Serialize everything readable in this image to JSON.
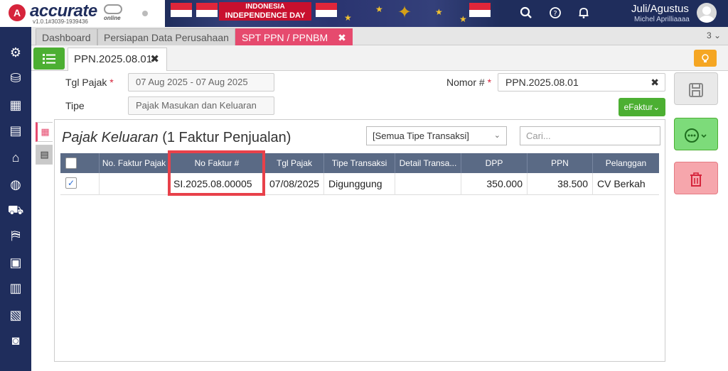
{
  "app": {
    "logo_mark": "A",
    "logo_text": "accurate",
    "logo_sub": "online",
    "version": "v1.0.1#3039-1939436"
  },
  "banner": {
    "line1": "INDONESIA",
    "line2": "INDEPENDENCE DAY"
  },
  "user": {
    "period": "Juli/Agustus",
    "name": "Michel Aprilliaaaa"
  },
  "tabs": [
    {
      "label": "Dashboard"
    },
    {
      "label": "Persiapan Data Perusahaan"
    },
    {
      "label": "SPT PPN / PPNBM",
      "close": "✖"
    }
  ],
  "tab_count": "3 ⌄",
  "doc_tab": {
    "label": "PPN.2025.08.01",
    "close": "✖"
  },
  "form": {
    "tgl_pajak_label": "Tgl Pajak",
    "tgl_pajak_value": "07 Aug 2025 - 07 Aug 2025",
    "tipe_label": "Tipe",
    "tipe_value": "Pajak Masukan dan Keluaran",
    "nomor_label": "Nomor #",
    "nomor_value": "PPN.2025.08.01",
    "required_mark": "*",
    "clear_icon": "✖",
    "efaktur_label": "eFaktur⌄"
  },
  "panel": {
    "title_italic": "Pajak Keluaran",
    "title_rest": " (1 Faktur Penjualan)",
    "filter_value": "[Semua Tipe Transaksi]",
    "search_placeholder": "Cari..."
  },
  "table": {
    "headers": [
      "No. Faktur Pajak",
      "No Faktur #",
      "Tgl Pajak",
      "Tipe Transaksi",
      "Detail Transa...",
      "DPP",
      "PPN",
      "Pelanggan"
    ],
    "rows": [
      {
        "checked": true,
        "no_faktur_pajak": "",
        "no_faktur": "SI.2025.08.00005",
        "tgl_pajak": "07/08/2025",
        "tipe_transaksi": "Digunggung",
        "detail_transaksi": "",
        "dpp": "350.000",
        "ppn": "38.500",
        "pelanggan": "CV Berkah"
      }
    ]
  },
  "colors": {
    "nav": "#1f2d5c",
    "accent_pink": "#e64a6e",
    "green": "#4caf32",
    "highlight": "#e8414a",
    "table_header": "#5a6a85"
  }
}
